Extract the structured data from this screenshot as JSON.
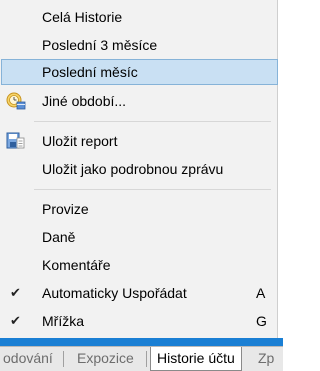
{
  "menu": {
    "items": [
      {
        "label": "Celá Historie"
      },
      {
        "label": "Poslední 3 měsíce"
      },
      {
        "label": "Poslední měsíc"
      },
      {
        "label": "Jiné období..."
      },
      {
        "label": "Uložit report"
      },
      {
        "label": "Uložit jako podrobnou zprávu"
      },
      {
        "label": "Provize"
      },
      {
        "label": "Daně"
      },
      {
        "label": "Komentáře"
      },
      {
        "label": "Automaticky Uspořádat",
        "shortcut": "A",
        "checked": true
      },
      {
        "label": "Mřížka",
        "shortcut": "G",
        "checked": true
      }
    ],
    "check_glyph": "✔",
    "highlight_color": "#c9e0f3"
  },
  "tabs": [
    {
      "label": "odování"
    },
    {
      "label": "Expozice"
    },
    {
      "label": "Historie účtu",
      "active": true
    },
    {
      "label": "Zp"
    }
  ],
  "accent_color": "#1a7fd4"
}
